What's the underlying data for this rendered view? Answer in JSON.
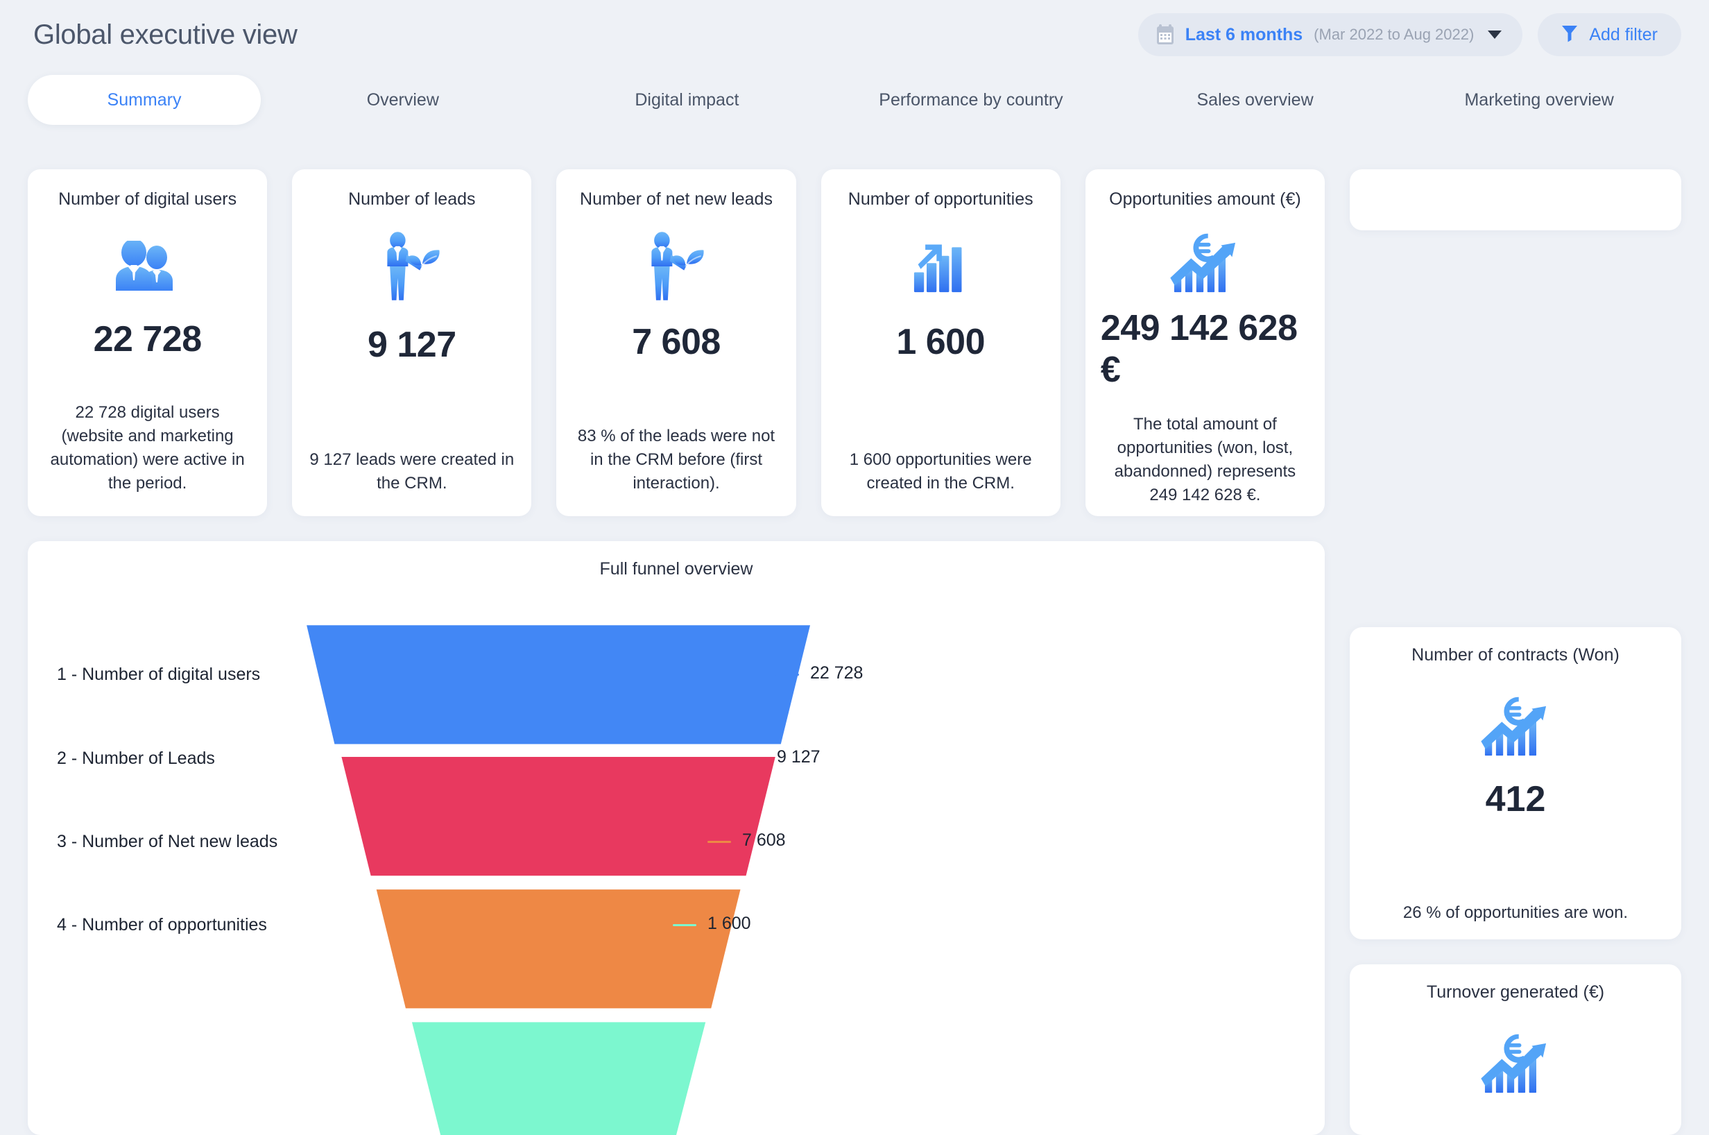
{
  "header": {
    "title": "Global executive view",
    "date_filter": {
      "icon": "calendar-icon",
      "label": "Last 6 months",
      "range": "(Mar 2022 to Aug 2022)"
    },
    "add_filter": {
      "icon": "funnel-filter-icon",
      "label": "Add filter"
    }
  },
  "tabs": [
    {
      "label": "Summary",
      "active": true
    },
    {
      "label": "Overview",
      "active": false
    },
    {
      "label": "Digital impact",
      "active": false
    },
    {
      "label": "Performance by country",
      "active": false
    },
    {
      "label": "Sales overview",
      "active": false
    },
    {
      "label": "Marketing overview",
      "active": false
    }
  ],
  "kpis": [
    {
      "title": "Number of digital users",
      "icon": "two-users-icon",
      "value": "22 728",
      "description": "22 728 digital users (website and marketing automation) were active in the period."
    },
    {
      "title": "Number of leads",
      "icon": "person-with-sprout-icon",
      "value": "9 127",
      "description": "9 127 leads were created in the CRM."
    },
    {
      "title": "Number of net new leads",
      "icon": "person-with-sprout-icon",
      "value": "7 608",
      "description": "83 % of the leads were not in the CRM before (first interaction)."
    },
    {
      "title": "Number of opportunities",
      "icon": "bar-chart-arrow-icon",
      "value": "1 600",
      "description": "1 600 opportunities were created in the CRM."
    },
    {
      "title": "Opportunities amount (€)",
      "icon": "euro-growth-chart-icon",
      "value": "249 142 628 €",
      "description": "The total amount of opportunities (won, lost, abandonned) represents 249 142 628 €."
    }
  ],
  "side_cards": [
    {
      "title": "Number of contracts (Won)",
      "icon": "euro-growth-chart-icon",
      "value": "412",
      "description": "26 % of opportunities are won."
    },
    {
      "title": "Turnover generated (€)",
      "icon": "euro-growth-chart-icon",
      "value": "",
      "description": ""
    }
  ],
  "chart_data": {
    "type": "funnel",
    "title": "Full funnel overview",
    "categories": [
      "1 - Number of digital users",
      "2 - Number of Leads",
      "3 - Number of Net new leads",
      "4 - Number of opportunities"
    ],
    "values": [
      22728,
      9127,
      7608,
      1600
    ],
    "value_labels": [
      "22 728",
      "9 127",
      "7 608",
      "1 600"
    ],
    "colors": [
      "#4287f5",
      "#e8395f",
      "#ee8845",
      "#7cf7cf"
    ],
    "legend": "none",
    "grid": false
  },
  "colors": {
    "accent": "#3b82f6",
    "page_bg": "#eef1f6",
    "card_bg": "#ffffff",
    "text": "#2a3142",
    "muted": "#9aa3b3"
  }
}
